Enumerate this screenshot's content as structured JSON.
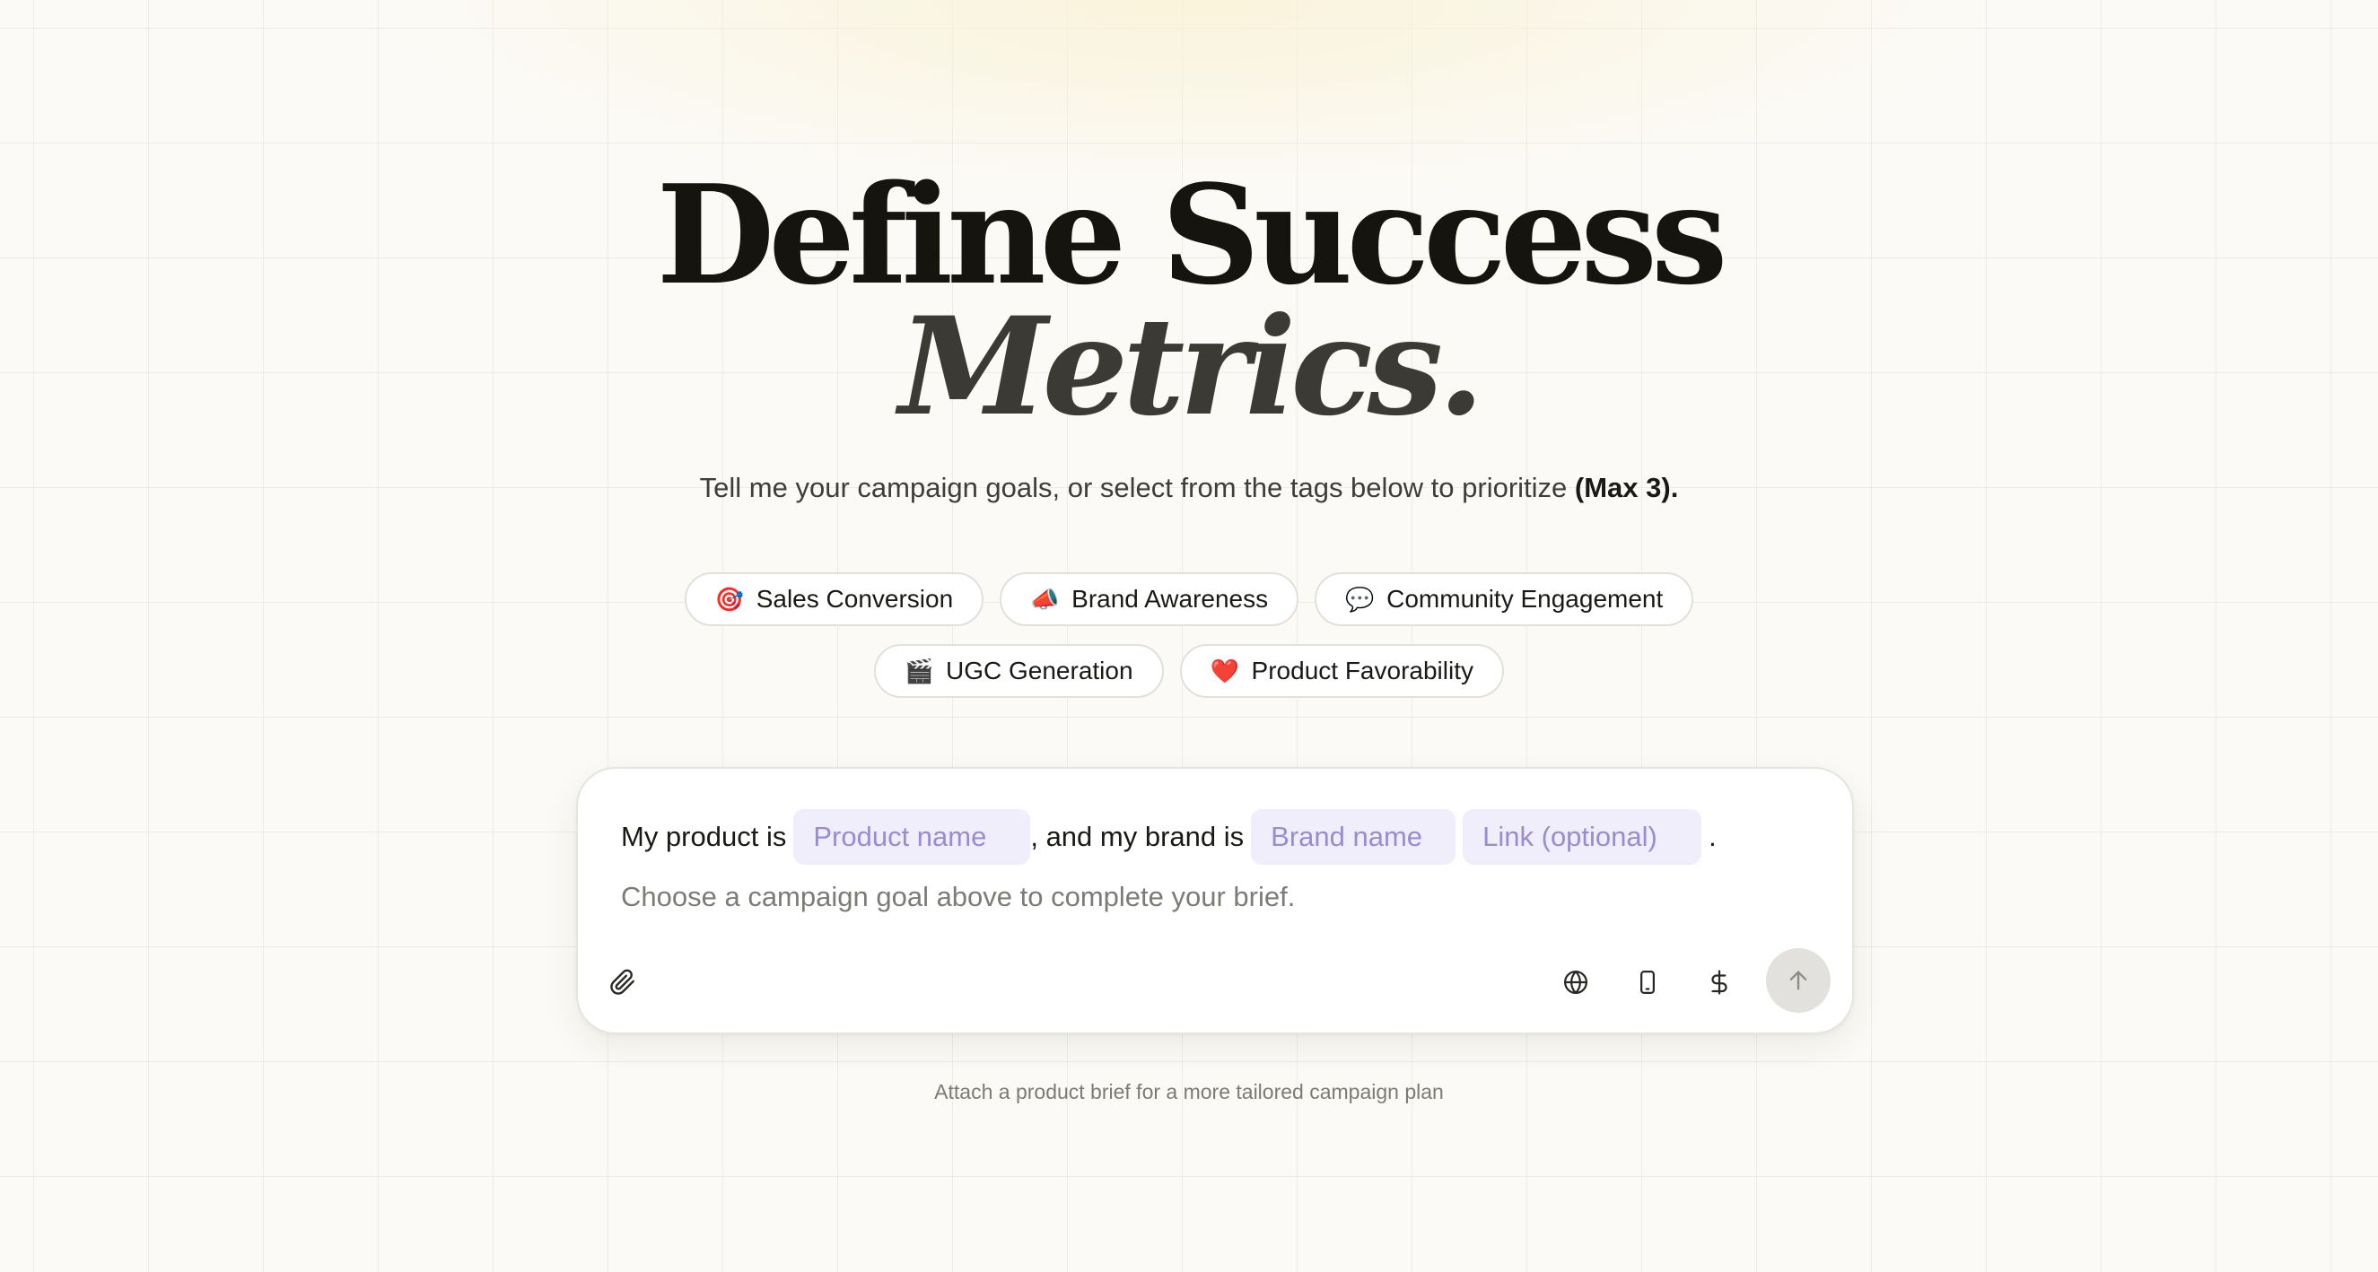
{
  "headline": {
    "line1": "Define Success",
    "line2": "Metrics."
  },
  "subtitle": {
    "text": "Tell me your campaign goals, or select from the tags below to prioritize ",
    "emphasis": "(Max 3)."
  },
  "tags": [
    {
      "emoji": "🎯",
      "icon": "target-icon",
      "label": "Sales Conversion"
    },
    {
      "emoji": "📣",
      "icon": "megaphone-icon",
      "label": "Brand Awareness"
    },
    {
      "emoji": "💬",
      "icon": "speech-bubble-icon",
      "label": "Community Engagement"
    },
    {
      "emoji": "🎬",
      "icon": "clapperboard-icon",
      "label": "UGC Generation"
    },
    {
      "emoji": "❤️",
      "icon": "heart-icon",
      "label": "Product Favorability"
    }
  ],
  "composer": {
    "prefix": "My product is",
    "product_placeholder": "Product name",
    "middle": ", and my brand is",
    "brand_placeholder": "Brand name",
    "link_placeholder": "Link (optional)",
    "suffix": ".",
    "hint": "Choose a campaign goal above to complete your brief.",
    "icons": {
      "attach": "paperclip-icon",
      "globe": "globe-icon",
      "phone": "mobile-phone-icon",
      "dollar": "dollar-icon",
      "send": "arrow-up-icon"
    }
  },
  "footnote": "Attach a product brief for a more tailored campaign plan",
  "colors": {
    "background": "#fbfaf6",
    "slot_background": "#f1eefb",
    "slot_text": "#9a8cd0",
    "send_button": "#e2e1de"
  }
}
